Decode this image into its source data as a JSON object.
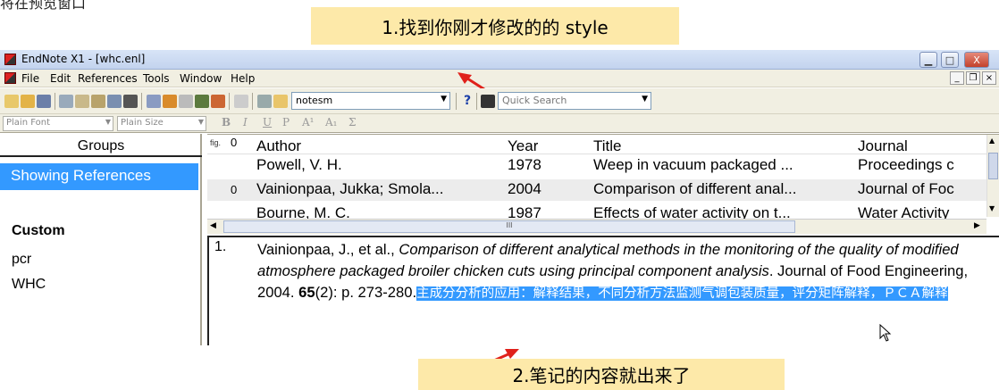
{
  "page_top_text": "将在预览窗口",
  "annotations": {
    "top_caption": "1.找到你刚才修改的的 style",
    "bottom_caption": "2.笔记的内容就出来了"
  },
  "window": {
    "title": "EndNote X1 - [whc.enl]",
    "min": "▁",
    "max": "□",
    "close": "X",
    "mdi_min": "_",
    "mdi_restore": "❐",
    "mdi_close": "×"
  },
  "menu": [
    "File",
    "Edit",
    "References",
    "Tools",
    "Window",
    "Help"
  ],
  "toolbar": {
    "style_value": "notesm",
    "help": "?",
    "search_placeholder": "Quick Search"
  },
  "format_bar": {
    "font": "Plain Font",
    "size": "Plain Size",
    "bold": "B",
    "italic": "I",
    "underline": "U",
    "plain": "P",
    "superscript": "A¹",
    "subscript": "A₁",
    "symbol": "Σ"
  },
  "groups": {
    "header": "Groups",
    "showing": "Showing References",
    "custom_heading": "Custom",
    "items": [
      "pcr",
      "WHC"
    ]
  },
  "reference_list": {
    "columns": {
      "figure": "fig.",
      "attachment": "0",
      "author": "Author",
      "year": "Year",
      "title": "Title",
      "journal": "Journal"
    },
    "rows": [
      {
        "attach": "",
        "author": "Powell, V. H.",
        "year": "1978",
        "title": "Weep in vacuum packaged ...",
        "journal": "Proceedings c"
      },
      {
        "attach": "0",
        "author": "Vainionpaa, Jukka; Smola...",
        "year": "2004",
        "title": "Comparison of different anal...",
        "journal": "Journal of Foc"
      },
      {
        "attach": "",
        "author": "Bourne, M. C.",
        "year": "1987",
        "title": "Effects of water activity on t...",
        "journal": "Water Activity"
      }
    ],
    "hscroll_grip": "III"
  },
  "preview": {
    "number": "1.",
    "authors": "Vainionpaa, J., et al., ",
    "title": "Comparison of different analytical methods in the monitoring of the quality of modified atmosphere packaged broiler chicken cuts using principal component analysis",
    "journal_pre": ". Journal of Food Engineering, 2004. ",
    "volume": "65",
    "issue_pages": "(2): p. 273-280.",
    "note": "主成分分析的应用：解释结果，不同分析方法监测气调包装质量，评分矩阵解释，ＰＣＡ解释"
  },
  "colors": {
    "selection": "#3399ff",
    "caption_bg": "#fde9a9",
    "arrow": "#e0211b"
  }
}
